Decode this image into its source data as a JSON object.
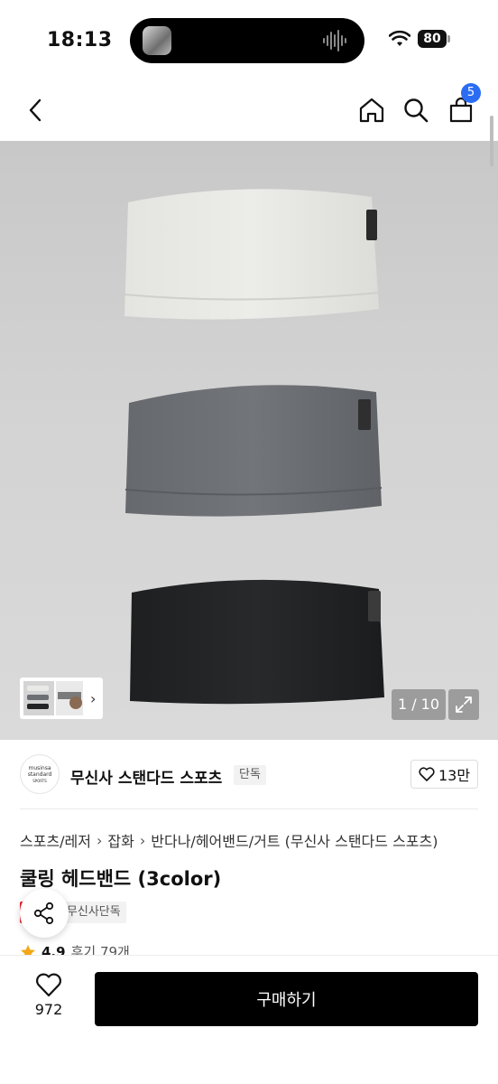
{
  "status_bar": {
    "time": "18:13",
    "battery": "80"
  },
  "header": {
    "cart_badge": "5"
  },
  "gallery": {
    "page_indicator": "1 / 10",
    "thumb_chevron": "›"
  },
  "brand": {
    "name": "무신사 스탠다드 스포츠",
    "exclusive_tag": "단독",
    "logo_lines": [
      "musinsa",
      "standard",
      "SPORTS"
    ],
    "like_count": "13만"
  },
  "breadcrumb": [
    "스포츠/레저",
    "잡화",
    "반다나/헤어밴드/거트 (무신사 스탠다드 스포츠)"
  ],
  "product": {
    "title": "쿨링 헤드밴드 (3color)",
    "sale_badge": "세일",
    "exclusive_badge": "무신사단독",
    "rating": "4.9",
    "reviews": "후기 79개"
  },
  "bottom_bar": {
    "wish_count": "972",
    "buy_label": "구매하기"
  },
  "colors": {
    "accent_blue": "#2a6df4",
    "sale_red": "#e8202a",
    "buy_black": "#000000"
  },
  "icons": [
    "back-icon",
    "home-icon",
    "search-icon",
    "cart-icon",
    "expand-icon",
    "heart-icon",
    "share-icon",
    "star-icon",
    "wifi-icon"
  ]
}
